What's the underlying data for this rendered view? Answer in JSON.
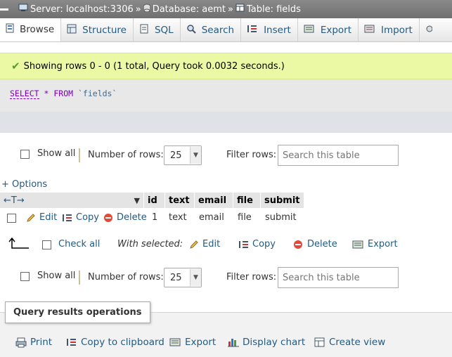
{
  "breadcrumb": {
    "server": "Server: localhost:3306",
    "database": "Database: aemt",
    "table": "Table: fields",
    "separator": "»"
  },
  "tabs": [
    {
      "label": "Browse",
      "icon": "browse-icon",
      "active": true
    },
    {
      "label": "Structure",
      "icon": "structure-icon"
    },
    {
      "label": "SQL",
      "icon": "sql-icon"
    },
    {
      "label": "Search",
      "icon": "search-icon"
    },
    {
      "label": "Insert",
      "icon": "insert-icon"
    },
    {
      "label": "Export",
      "icon": "export-icon"
    },
    {
      "label": "Import",
      "icon": "import-icon"
    }
  ],
  "message": {
    "text": "Showing rows 0 - 0 (1 total, Query took 0.0032 seconds.)",
    "color": "#ebf8a4"
  },
  "sql": {
    "select": "SELECT",
    "star": "*",
    "from": "FROM",
    "table": "`fields`"
  },
  "nav": {
    "show_all": "Show all",
    "number_of_rows_label": "Number of rows:",
    "rows_value": "25",
    "filter_label": "Filter rows:",
    "filter_placeholder": "Search this table"
  },
  "options_link": "+ Options",
  "resize_arrows": "←T→",
  "columns": [
    "id",
    "text",
    "email",
    "file",
    "submit"
  ],
  "rows": [
    {
      "id": "1",
      "text": "text",
      "email": "email",
      "file": "file",
      "submit": "submit"
    }
  ],
  "row_actions": {
    "edit": "Edit",
    "copy": "Copy",
    "delete": "Delete"
  },
  "bulk": {
    "check_all": "Check all",
    "with_selected": "With selected:",
    "edit": "Edit",
    "copy": "Copy",
    "delete": "Delete",
    "export": "Export"
  },
  "query_ops": {
    "title": "Query results operations",
    "print": "Print",
    "copy_clipboard": "Copy to clipboard",
    "export": "Export",
    "display_chart": "Display chart",
    "create_view": "Create view"
  }
}
